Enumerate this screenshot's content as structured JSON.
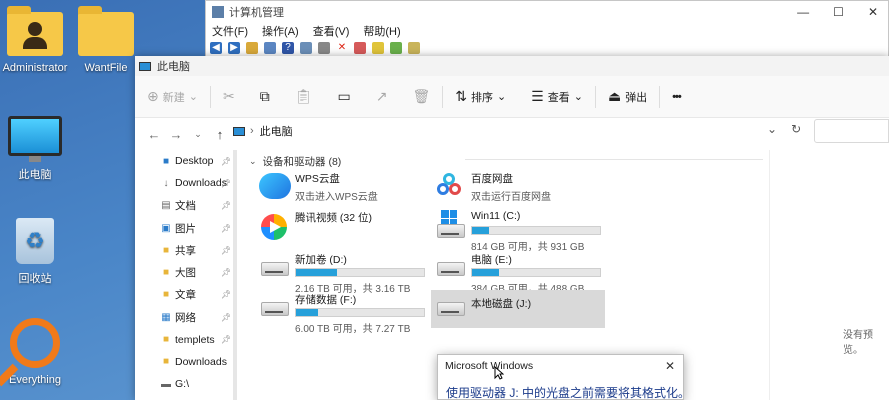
{
  "desktop": {
    "icons": [
      {
        "label": "Administrator"
      },
      {
        "label": "WantFile"
      },
      {
        "label": "此电脑"
      },
      {
        "label": "回收站"
      },
      {
        "label": "Everything"
      }
    ]
  },
  "mgmt": {
    "title": "计算机管理",
    "menu": [
      "文件(F)",
      "操作(A)",
      "查看(V)",
      "帮助(H)"
    ],
    "controls": {
      "min": "—",
      "max": "☐",
      "close": "✕"
    }
  },
  "explorer": {
    "title": "此电脑",
    "toolbar": {
      "new": "新建",
      "sort": "排序",
      "view": "查看",
      "eject": "弹出",
      "more": "•••"
    },
    "address": "此电脑",
    "sidebar": [
      {
        "label": "Desktop",
        "icon": "desktop-icon"
      },
      {
        "label": "Downloads",
        "icon": "download-icon"
      },
      {
        "label": "文档",
        "icon": "documents-icon"
      },
      {
        "label": "图片",
        "icon": "pictures-icon"
      },
      {
        "label": "共享",
        "icon": "folder-icon"
      },
      {
        "label": "大图",
        "icon": "folder-icon"
      },
      {
        "label": "文章",
        "icon": "folder-icon"
      },
      {
        "label": "网络",
        "icon": "network-icon"
      },
      {
        "label": "templets",
        "icon": "folder-icon"
      },
      {
        "label": "Downloads",
        "icon": "folder-icon"
      },
      {
        "label": "G:\\",
        "icon": "drive-icon"
      }
    ],
    "group_header": "设备和驱动器 (8)",
    "drives": [
      {
        "name": "WPS云盘",
        "sub": "双击进入WPS云盘"
      },
      {
        "name": "百度网盘",
        "sub": "双击运行百度网盘"
      },
      {
        "name": "腾讯视频 (32 位)"
      },
      {
        "name": "Win11 (C:)",
        "sub": "814 GB 可用，共 931 GB",
        "used": 0.13
      },
      {
        "name": "新加卷 (D:)",
        "sub": "2.16 TB 可用，共 3.16 TB",
        "used": 0.32
      },
      {
        "name": "电脑 (E:)",
        "sub": "384 GB 可用，共 488 GB",
        "used": 0.21
      },
      {
        "name": "存储数据 (F:)",
        "sub": "6.00 TB 可用，共 7.27 TB",
        "used": 0.17
      },
      {
        "name": "本地磁盘 (J:)"
      }
    ],
    "preview": "没有预览。"
  },
  "dialog": {
    "title": "Microsoft Windows",
    "message": "使用驱动器 J: 中的光盘之前需要将其格式化。",
    "close": "✕"
  }
}
